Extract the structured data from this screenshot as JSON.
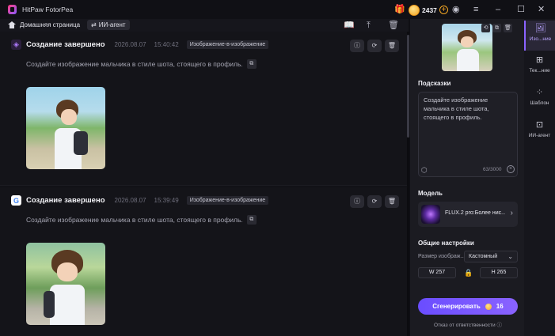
{
  "app": {
    "title": "HitPaw FotorPea"
  },
  "credits": {
    "amount": "2437"
  },
  "toolbar": {
    "home_label": "Домашняя страница",
    "agent_label": "ИИ-агент"
  },
  "cards": [
    {
      "provider": "A",
      "title": "Создание завершено",
      "date": "2026.08.07",
      "time": "15:40:42",
      "badge": "Изображение-в-изображение",
      "prompt": "Создайте изображение мальчика в стиле шота, стоящего в профиль."
    },
    {
      "provider": "G",
      "title": "Создание завершено",
      "date": "2026.08.07",
      "time": "15:39:49",
      "badge": "Изображение-в-изображение",
      "prompt": "Создайте изображение мальчика в стиле шота, стоящего в профиль."
    }
  ],
  "panel": {
    "hints_title": "Подсказки",
    "prompt_text": "Создайте изображение мальчика в стиле шота, стоящего в профиль.",
    "counter": "63/3000",
    "model_title": "Модель",
    "model_name": "FLUX.2 pro:Более нис...",
    "settings_title": "Общие настройки",
    "size_label": "Размер изображ...",
    "size_value": "Кастомный",
    "width": "W  257",
    "height": "H  265",
    "generate_label": "Сгенерировать",
    "generate_cost": "16",
    "disclaimer": "Отказ от ответственности"
  },
  "nav": {
    "items": [
      {
        "label": "Изо...ние",
        "icon": "image-icon"
      },
      {
        "label": "Тек...ние",
        "icon": "text-image-icon"
      },
      {
        "label": "Шаблон",
        "icon": "template-icon"
      },
      {
        "label": "ИИ-агент",
        "icon": "ai-agent-icon"
      }
    ]
  }
}
